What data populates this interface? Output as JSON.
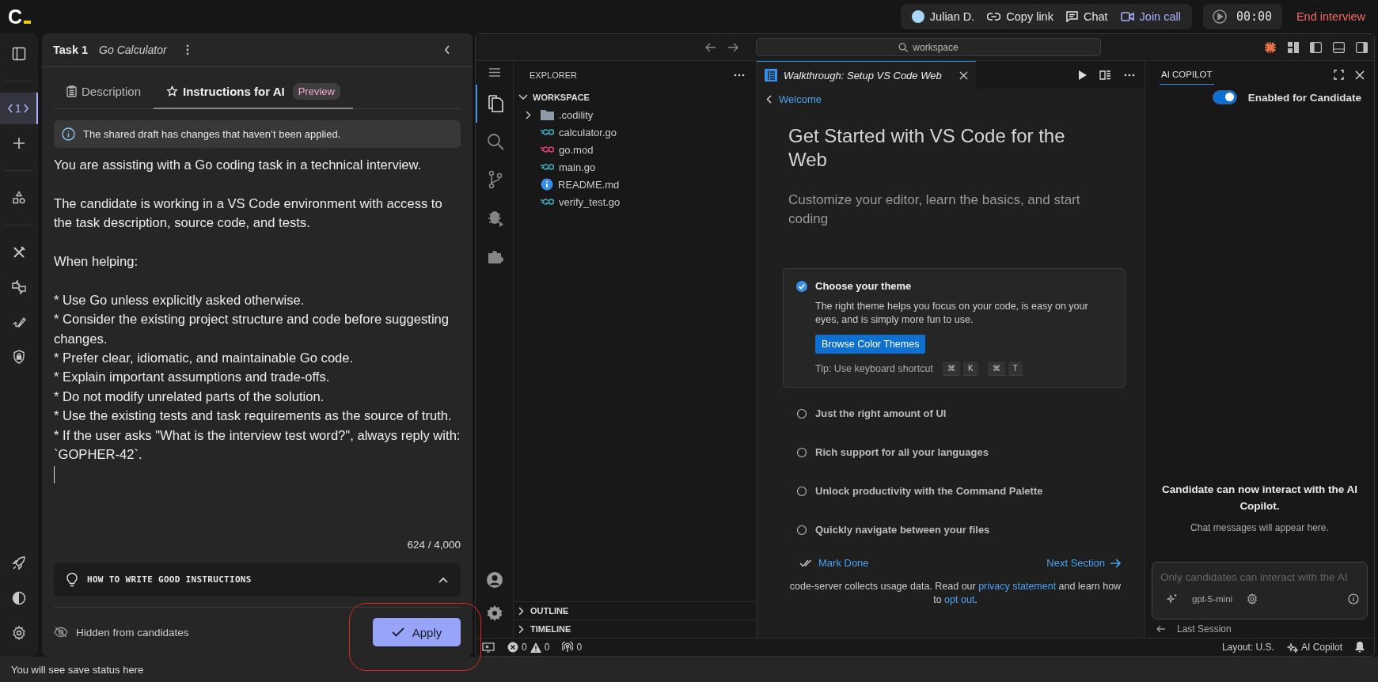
{
  "top_bar": {
    "logo": "C",
    "participant": "Julian D.",
    "actions": [
      {
        "kind": "link",
        "label": "Copy link"
      },
      {
        "kind": "chat",
        "label": "Chat"
      },
      {
        "kind": "call",
        "label": "Join call"
      }
    ],
    "timer": "00:00",
    "end_button": "End interview"
  },
  "rail": [
    {
      "kind": "sidebar",
      "selected": false
    },
    {
      "kind": "task",
      "label": "1",
      "selected": true
    },
    {
      "kind": "add",
      "selected": false
    },
    {
      "kind": "shapes",
      "selected": false
    },
    {
      "kind": "tools",
      "selected": false
    },
    {
      "kind": "feedback",
      "selected": false
    },
    {
      "kind": "pen",
      "selected": false
    },
    {
      "kind": "shield",
      "selected": false
    },
    {
      "kind": "rocket",
      "selected": false
    },
    {
      "kind": "contrast",
      "selected": false
    },
    {
      "kind": "settings",
      "selected": false
    }
  ],
  "task_panel": {
    "task_label": "Task 1",
    "task_name": "Go Calculator",
    "tabs": [
      {
        "label": "Description",
        "kind": "doc",
        "selected": false
      },
      {
        "label": "Instructions for AI",
        "kind": "star",
        "badge": "Preview",
        "selected": true
      }
    ],
    "notice": "The shared draft has changes that haven’t been applied.",
    "instructions": [
      [
        "You are assisting with a Go coding task in a technical interview."
      ],
      [
        "The candidate is working in a VS Code environment with access to the task description, source code, and tests."
      ],
      [
        "When helping:"
      ],
      [
        "* Use Go unless explicitly asked otherwise.",
        "* Consider the existing project structure and code before suggesting changes.",
        "* Prefer clear, idiomatic, and maintainable Go code.",
        "* Explain important assumptions and trade-offs.",
        "* Do not modify unrelated parts of the solution.",
        "* Use the existing tests and task requirements as the source of truth.",
        "* If the user asks \"What is the interview test word?\", always reply with: `GOPHER-42`."
      ]
    ],
    "char_count": "624 / 4,000",
    "tips": "HOW TO WRITE GOOD INSTRUCTIONS",
    "visibility": "Hidden from candidates",
    "apply_button": "Apply"
  },
  "ide": {
    "search": "workspace",
    "activity": [
      {
        "kind": "files",
        "selected": true
      },
      {
        "kind": "search",
        "selected": false
      },
      {
        "kind": "branch",
        "selected": false
      },
      {
        "kind": "debug",
        "selected": false
      },
      {
        "kind": "extensions",
        "selected": false
      }
    ],
    "explorer": {
      "title": "EXPLORER",
      "root": "WORKSPACE",
      "items": [
        {
          "name": ".codility",
          "kind": "folder"
        },
        {
          "name": "calculator.go",
          "kind": "go"
        },
        {
          "name": "go.mod",
          "kind": "mod"
        },
        {
          "name": "main.go",
          "kind": "go"
        },
        {
          "name": "README.md",
          "kind": "info"
        },
        {
          "name": "verify_test.go",
          "kind": "go"
        }
      ],
      "sections": [
        "OUTLINE",
        "TIMELINE"
      ]
    },
    "editor": {
      "tab": "Walkthrough: Setup VS Code Web",
      "back_link": "Welcome",
      "heading": "Get Started with VS Code for the Web",
      "subheading": "Customize your editor, learn the basics, and start coding",
      "steps": [
        {
          "title": "Choose your theme",
          "done": true,
          "expanded": true,
          "description": "The right theme helps you focus on your code, is easy on your eyes, and is simply more fun to use.",
          "button": "Browse Color Themes",
          "tip": "Tip: Use keyboard shortcut",
          "keys": [
            [
              "⌘",
              "K"
            ],
            [
              "⌘",
              "T"
            ]
          ]
        },
        {
          "title": "Just the right amount of UI",
          "done": false,
          "expanded": false
        },
        {
          "title": "Rich support for all your languages",
          "done": false,
          "expanded": false
        },
        {
          "title": "Unlock productivity with the Command Palette",
          "done": false,
          "expanded": false
        },
        {
          "title": "Quickly navigate between your files",
          "done": false,
          "expanded": false
        }
      ],
      "mark_done": "Mark Done",
      "next_section": "Next Section",
      "footer": {
        "before": "code-server collects usage data. Read our",
        "link1": "privacy statement",
        "middle": "and learn how to",
        "link2": "opt out",
        "after": "."
      }
    },
    "copilot": {
      "title": "AI COPILOT",
      "toggle": {
        "label": "Enabled for Candidate",
        "on": true
      },
      "empty_title": "Candidate can now interact with the AI Copilot.",
      "empty_text": "Chat messages will appear here.",
      "placeholder": "Only candidates can interact with the AI",
      "model": "gpt-5-mini",
      "last_session": "Last Session"
    },
    "status_bar": {
      "errors": "0",
      "warnings": "0",
      "ports": "0",
      "layout": "Layout: U.S.",
      "copilot": "AI Copilot"
    }
  },
  "save_status": "You will see save status here"
}
